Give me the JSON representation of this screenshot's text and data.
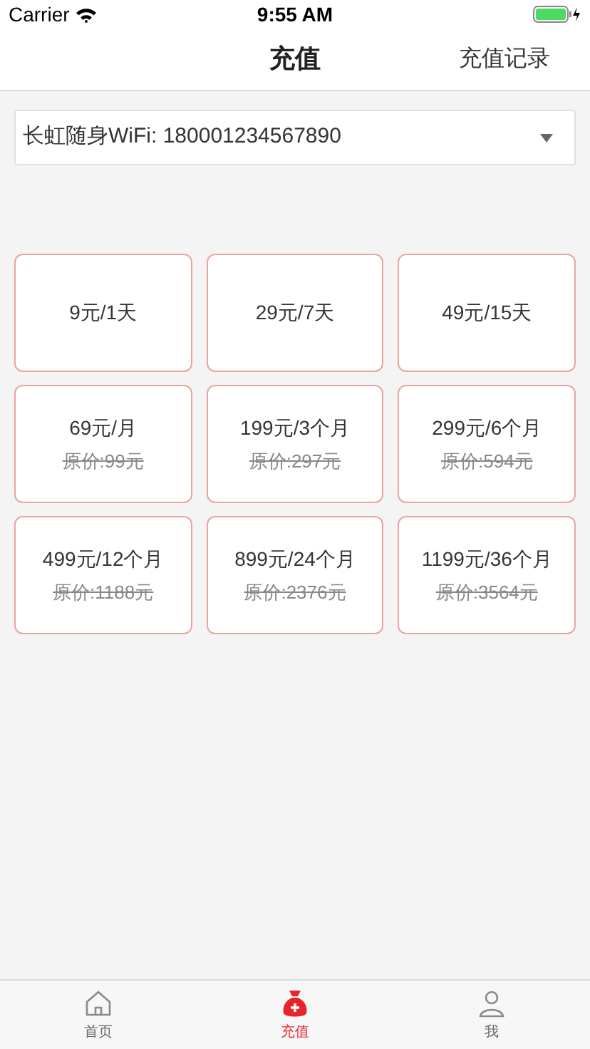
{
  "status_bar": {
    "carrier": "Carrier",
    "time": "9:55 AM"
  },
  "nav": {
    "title": "充值",
    "action": "充值记录"
  },
  "device_select": {
    "value": "长虹随身WiFi: 180001234567890"
  },
  "plans": [
    {
      "price": "9元/1天"
    },
    {
      "price": "29元/7天"
    },
    {
      "price": "49元/15天"
    },
    {
      "price": "69元/月",
      "original": "原价:99元"
    },
    {
      "price": "199元/3个月",
      "original": "原价:297元"
    },
    {
      "price": "299元/6个月",
      "original": "原价:594元"
    },
    {
      "price": "499元/12个月",
      "original": "原价:1188元"
    },
    {
      "price": "899元/24个月",
      "original": "原价:2376元"
    },
    {
      "price": "1199元/36个月",
      "original": "原价:3564元"
    }
  ],
  "tab_bar": [
    {
      "label": "首页",
      "kind": "home",
      "selected": false
    },
    {
      "label": "充值",
      "kind": "bag",
      "selected": true
    },
    {
      "label": "我",
      "kind": "person",
      "selected": false
    }
  ]
}
